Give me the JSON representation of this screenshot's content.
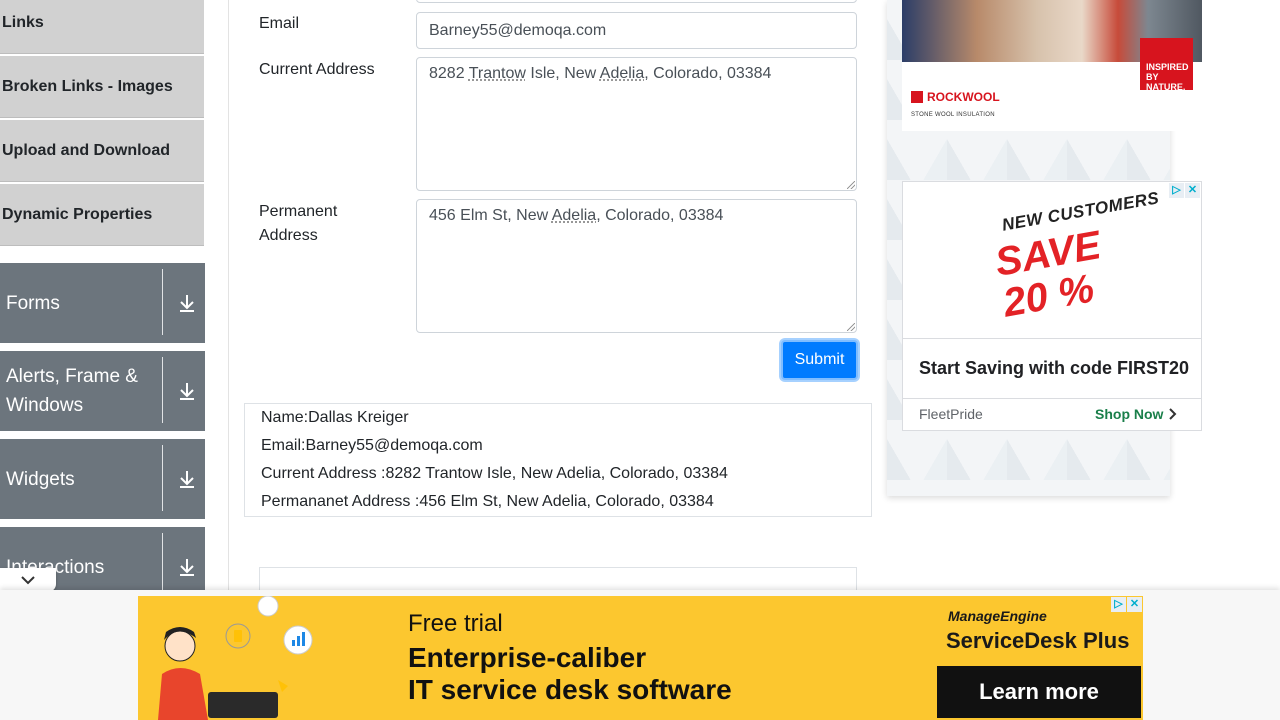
{
  "sidebar": {
    "items": [
      {
        "label": "Links"
      },
      {
        "label": "Broken Links - Images"
      },
      {
        "label": "Upload and Download"
      },
      {
        "label": "Dynamic Properties"
      }
    ],
    "groups": [
      {
        "line1": "Forms",
        "line2": ""
      },
      {
        "line1": "Alerts, Frame &",
        "line2": "Windows"
      },
      {
        "line1": "Widgets",
        "line2": ""
      },
      {
        "line1": "Interactions",
        "line2": ""
      }
    ]
  },
  "form": {
    "email_label": "Email",
    "email_value": "Barney55@demoqa.com",
    "current_address_label": "Current Address",
    "current_address": {
      "p1": "8282 ",
      "u1": "Trantow",
      "p2": " Isle, New ",
      "u2": "Adelia",
      "p3": ", Colorado, 03384"
    },
    "permanent_address_label_1": "Permanent",
    "permanent_address_label_2": "Address",
    "permanent_address": {
      "p1": "456 Elm St, New ",
      "u1": "Adelia",
      "p2": ", Colorado, 03384"
    },
    "submit_label": "Submit"
  },
  "output": {
    "name": "Name:Dallas Kreiger",
    "email": "Email:Barney55@demoqa.com",
    "current_address": "Current Address :8282 Trantow Isle, New Adelia, Colorado, 03384",
    "permanent_address": "Permananet Address :456 Elm St, New Adelia, Colorado, 03384"
  },
  "ads": {
    "rockwool": {
      "badge": "INSPIRED BY NATURE.",
      "brand": "ROCKWOOL",
      "tagline": "STONE WOOL INSULATION"
    },
    "fleetpride": {
      "line1": "NEW CUSTOMERS",
      "line2": "SAVE",
      "line3": "20 %",
      "headline": "Start Saving with code FIRST20",
      "advertiser": "FleetPride",
      "cta": "Shop Now"
    },
    "banner": {
      "line1": "Free trial",
      "line2": "Enterprise-caliber",
      "line3": "IT service desk software",
      "brand": "ManageEngine",
      "product": "ServiceDesk Plus",
      "cta": "Learn more"
    }
  },
  "colors": {
    "primary": "#007bff",
    "sidebar_group": "#6c757d",
    "sidebar_item": "#d1d1d1",
    "banner_bg": "#fcc72f"
  }
}
